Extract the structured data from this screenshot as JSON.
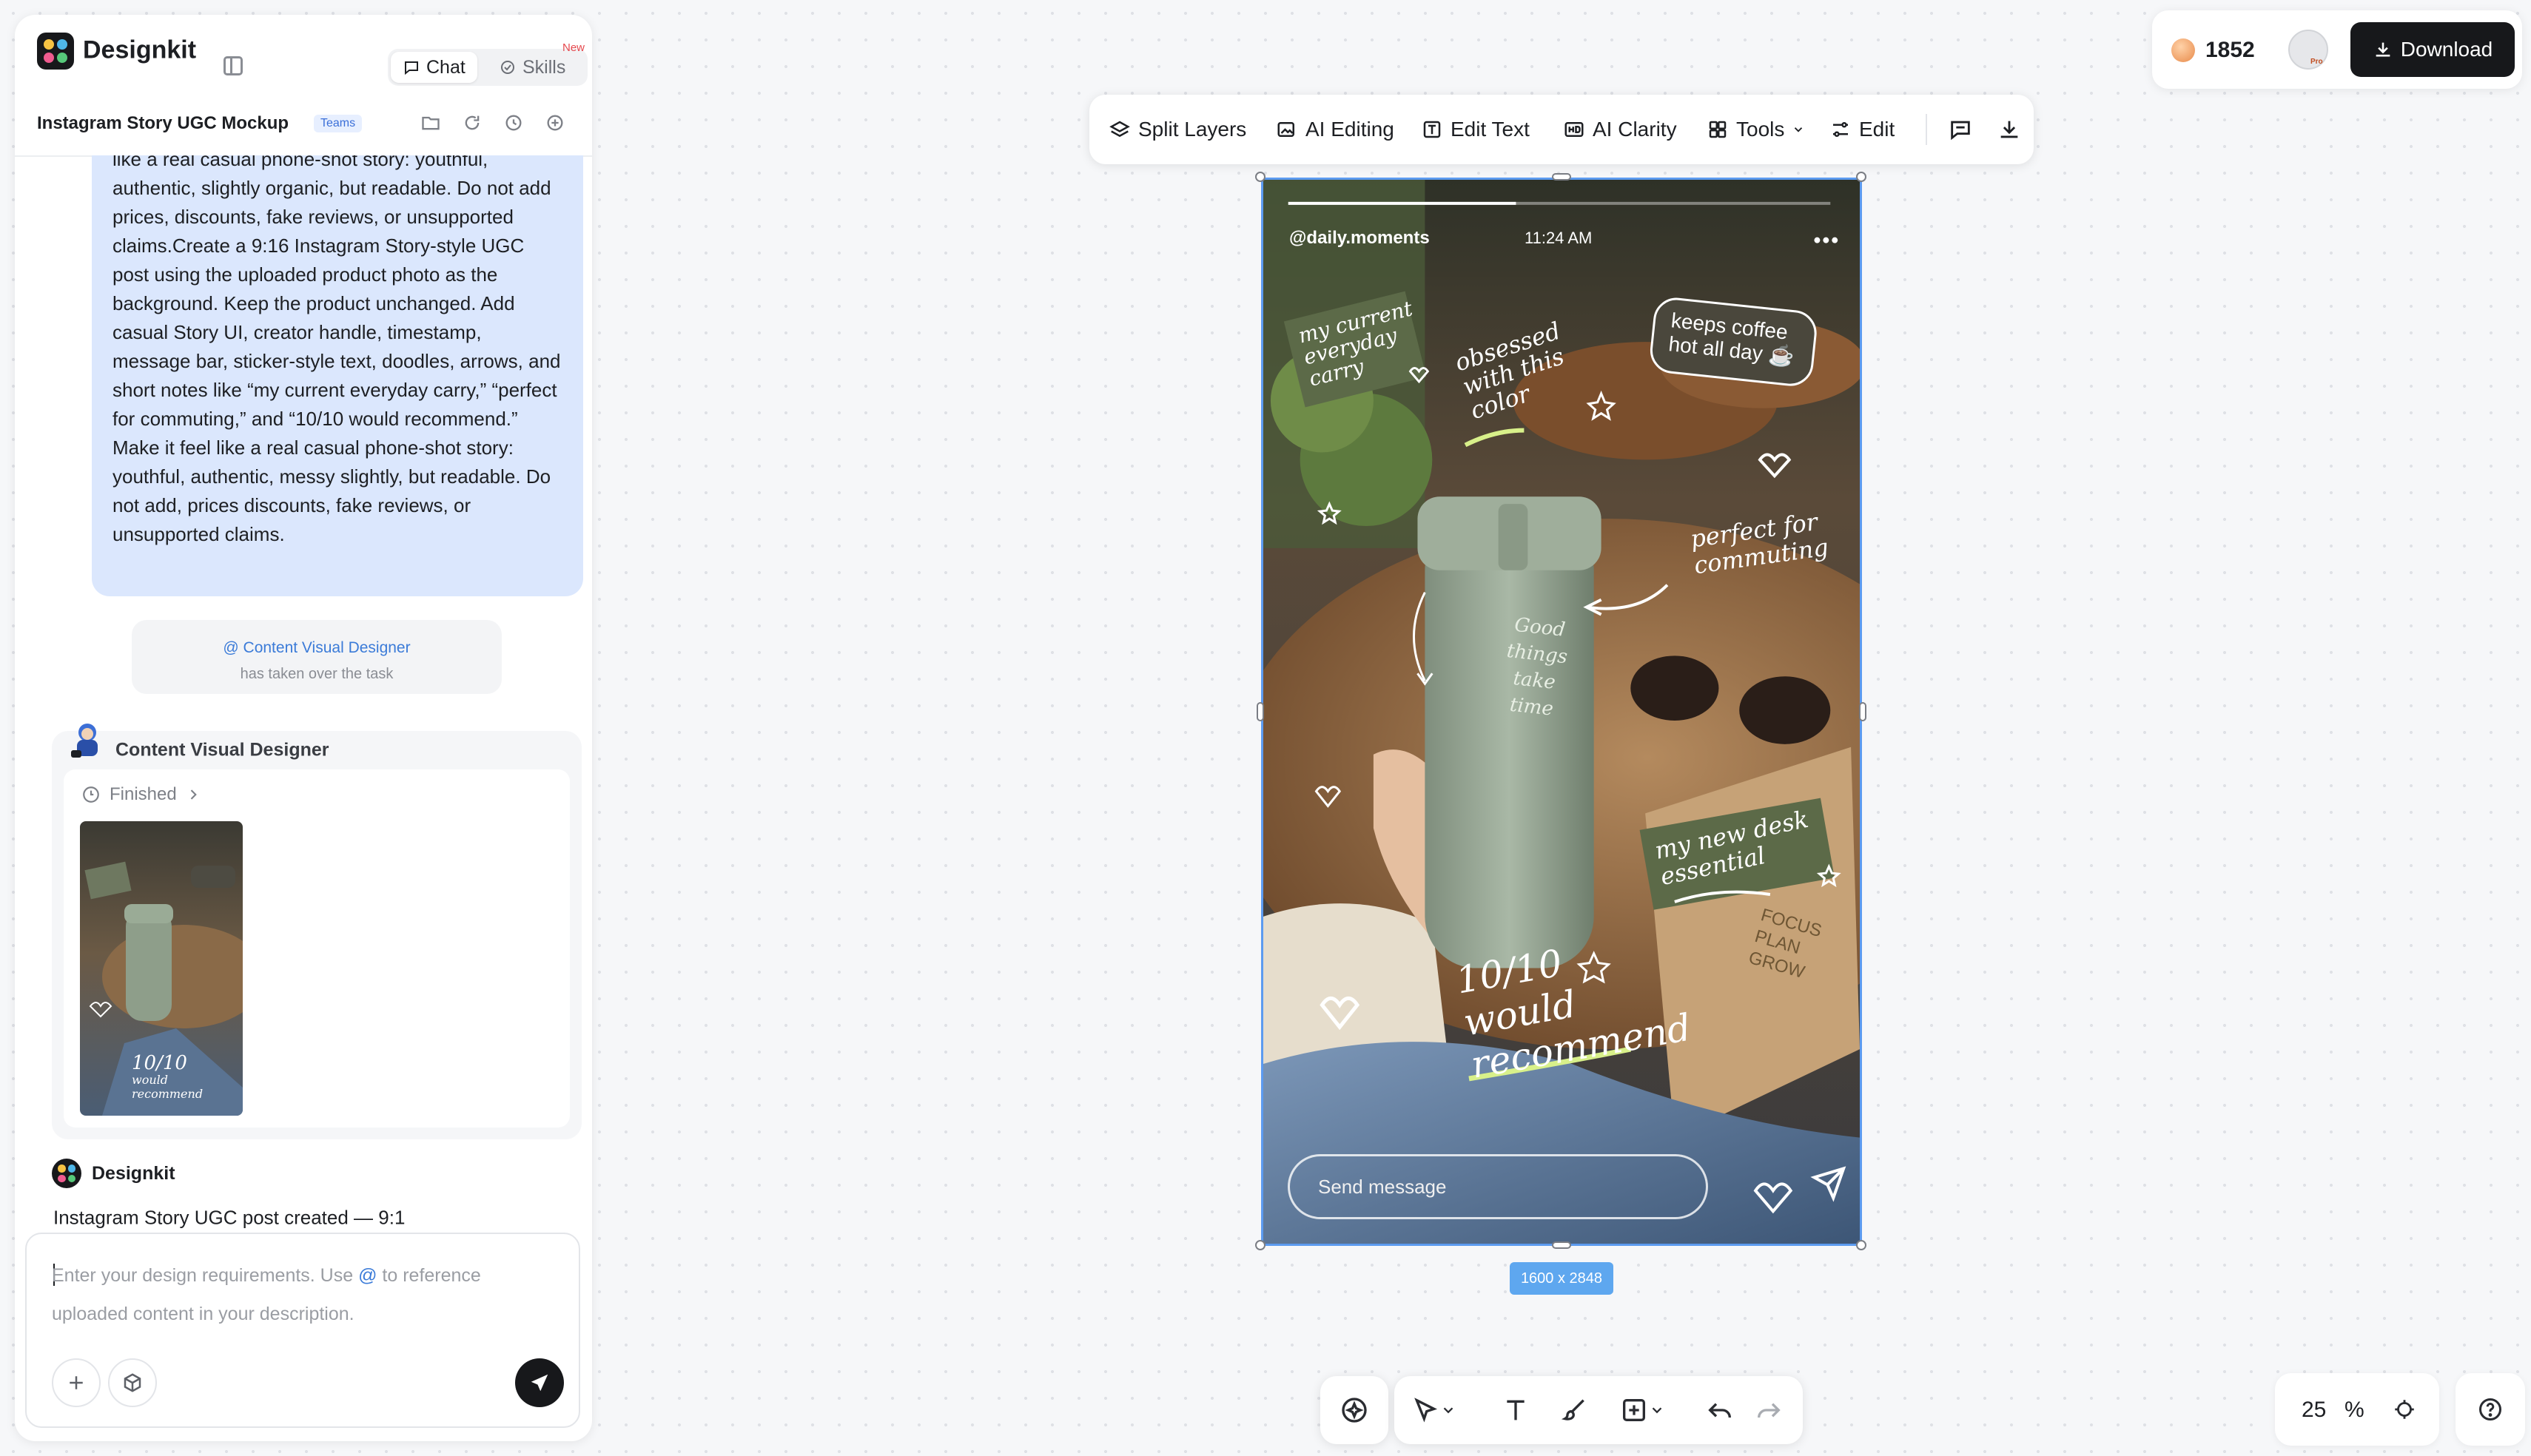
{
  "app": {
    "name": "Designkit",
    "tabs": {
      "chat": "Chat",
      "skills": "Skills",
      "skills_badge": "New"
    },
    "project_title": "Instagram Story UGC Mockup",
    "project_badge": "Teams"
  },
  "chat": {
    "prompt_text": "like a real casual phone-shot story: youthful, authentic, slightly organic, but readable. Do not add prices, discounts, fake reviews, or unsupported claims.Create a 9:16 Instagram Story-style UGC post using the uploaded product photo as the background. Keep the product unchanged. Add casual Story UI, creator handle, timestamp, message bar, sticker-style text, doodles, arrows, and short notes like “my current everyday carry,” “perfect for commuting,” and “10/10 would recommend.” Make it feel like a real casual phone-shot story: youthful, authentic, messy slightly, but readable. Do not add, prices discounts, fake reviews, or unsupported claims.",
    "handoff": {
      "agent": "@ Content Visual Designer",
      "note": "has taken over the task"
    },
    "agent_card": {
      "name": "Content Visual Designer",
      "status": "Finished"
    },
    "reply": {
      "sender": "Designkit",
      "message": "Instagram Story UGC post created — 9:1"
    },
    "input": {
      "placeholder_part1": "Enter your design requirements. Use ",
      "placeholder_at": "@",
      "placeholder_part2": " to reference uploaded content in your description."
    }
  },
  "toolbar": {
    "split_layers": "Split Layers",
    "ai_editing": "AI Editing",
    "edit_text": "Edit Text",
    "ai_clarity": "AI Clarity",
    "tools": "Tools",
    "edit": "Edit"
  },
  "account": {
    "credits": "1852",
    "download": "Download"
  },
  "story": {
    "handle": "@daily.moments",
    "time": "11:24 AM",
    "sticker_1": [
      "my current",
      "everyday",
      "carry"
    ],
    "sticker_2": [
      "obsessed",
      "with this",
      "color"
    ],
    "sticker_3": [
      "keeps coffee",
      "hot all day ☕"
    ],
    "sticker_4": [
      "perfect for",
      "commuting"
    ],
    "sticker_5": [
      "my new desk",
      "essential"
    ],
    "sticker_6": [
      "10/10",
      "would",
      "recommend"
    ],
    "cup_text": [
      "Good",
      "things",
      "take",
      "time"
    ],
    "notebook_text": [
      "FOCUS",
      "PLAN",
      "GROW"
    ],
    "send_placeholder": "Send message",
    "story_progress": 0.42
  },
  "canvas": {
    "size_label": "1600 x 2848",
    "zoom": "25",
    "zoom_unit": "%"
  },
  "colors": {
    "accent": "#5ea7ef",
    "selection": "#5c9bf0",
    "bubble": "#dbe7fd",
    "dark": "#17181b"
  }
}
